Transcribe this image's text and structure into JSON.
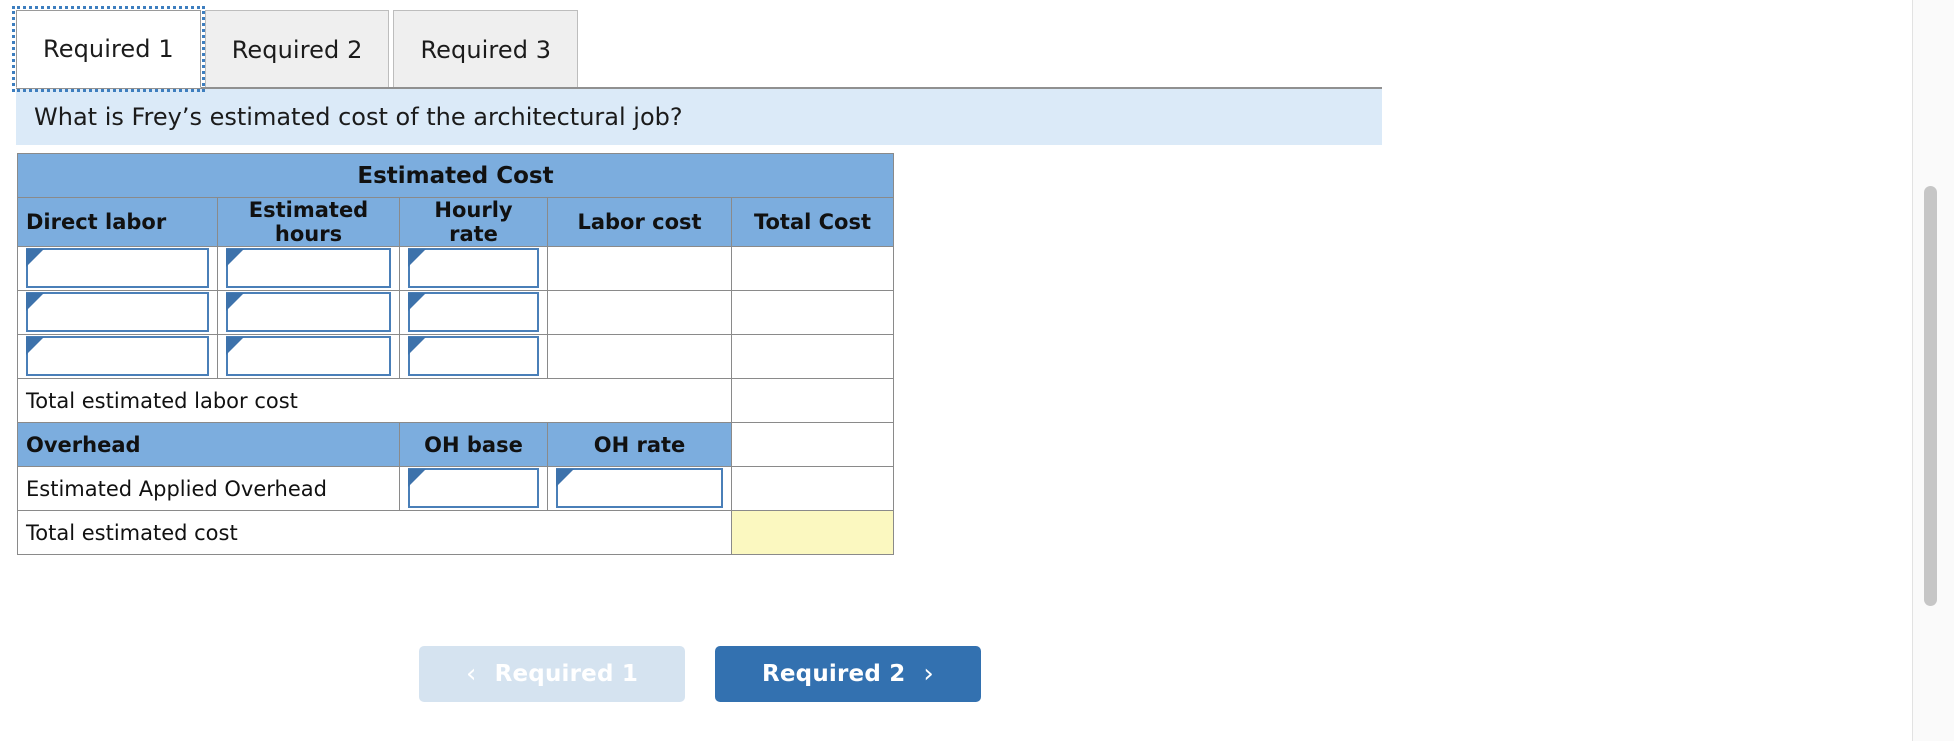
{
  "tabs": [
    {
      "label": "Required 1",
      "active": true
    },
    {
      "label": "Required 2",
      "active": false
    },
    {
      "label": "Required 3",
      "active": false
    }
  ],
  "question": {
    "text": "What is Frey’s estimated cost of the architectural job?"
  },
  "table": {
    "band_title": "Estimated Cost",
    "labor_headers": [
      "Direct labor",
      "Estimated hours",
      "Hourly rate",
      "Labor cost",
      "Total Cost"
    ],
    "labor_rows": [
      {
        "direct_labor": "",
        "estimated_hours": "",
        "hourly_rate": "",
        "labor_cost": "",
        "total_cost": ""
      },
      {
        "direct_labor": "",
        "estimated_hours": "",
        "hourly_rate": "",
        "labor_cost": "",
        "total_cost": ""
      },
      {
        "direct_labor": "",
        "estimated_hours": "",
        "hourly_rate": "",
        "labor_cost": "",
        "total_cost": ""
      }
    ],
    "total_labor_label": "Total estimated labor cost",
    "total_labor_value": "",
    "overhead_headers": [
      "Overhead",
      "OH base",
      "OH rate"
    ],
    "overhead_row": {
      "label": "Estimated Applied Overhead",
      "oh_base": "",
      "oh_rate": "",
      "total_cost": ""
    },
    "total_cost_label": "Total estimated cost",
    "total_cost_value": ""
  },
  "nav": {
    "prev_label": "Required 1",
    "prev_chevron": "‹",
    "next_label": "Required 2",
    "next_chevron": "›"
  },
  "colors": {
    "header_blue": "#7cadde",
    "banner_blue": "#dbeaf8",
    "input_border": "#4a7fb8",
    "total_yellow": "#fbf8c0",
    "next_button": "#3371b0",
    "prev_button": "#d5e3f0"
  }
}
